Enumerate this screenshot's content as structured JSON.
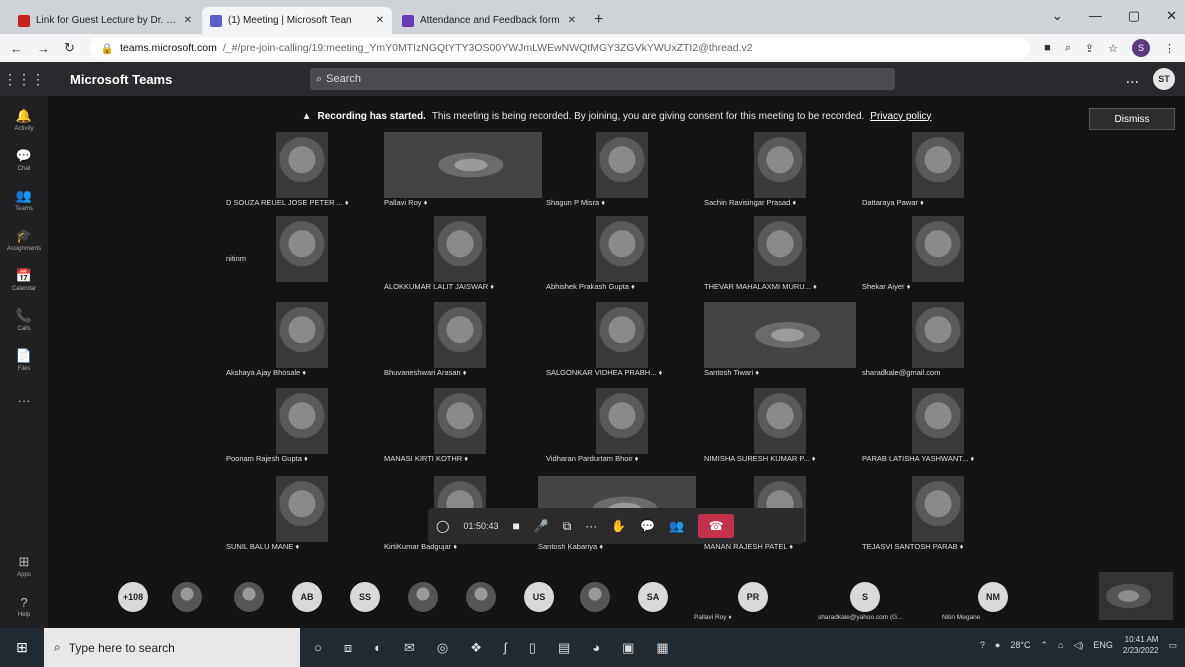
{
  "browser": {
    "tabs": [
      {
        "title": "Link for Guest Lecture by Dr. Shi",
        "favicon_color": "#c5221f",
        "active": false
      },
      {
        "title": "(1) Meeting | Microsoft Tean",
        "favicon_color": "#5b5fc7",
        "active": true
      },
      {
        "title": "Attendance and Feedback form",
        "favicon_color": "#673ab7",
        "active": false
      }
    ],
    "new_tab": "+",
    "url_host": "teams.microsoft.com",
    "url_path": "/_#/pre-join-calling/19:meeting_YmY0MTIzNGQtYTY3OS00YWJmLWEwNWQtMGY3ZGVkYWUxZTI2@thread.v2"
  },
  "teams": {
    "app_name": "Microsoft Teams",
    "search_placeholder": "Search",
    "user_initials": "ST",
    "more": "...",
    "rail": [
      {
        "icon": "🔔",
        "label": "Activity"
      },
      {
        "icon": "💬",
        "label": "Chat"
      },
      {
        "icon": "👥",
        "label": "Teams"
      },
      {
        "icon": "🎓",
        "label": "Assignments"
      },
      {
        "icon": "📅",
        "label": "Calendar"
      },
      {
        "icon": "📞",
        "label": "Calls"
      },
      {
        "icon": "📄",
        "label": "Files"
      },
      {
        "icon": "···",
        "label": ""
      }
    ],
    "rail_bottom": [
      {
        "icon": "⊞",
        "label": "Apps"
      },
      {
        "icon": "?",
        "label": "Help"
      }
    ]
  },
  "banner": {
    "title": "Recording has started.",
    "message": "This meeting is being recorded. By joining, you are giving consent for this meeting to be recorded.",
    "link": "Privacy policy",
    "dismiss": "Dismiss"
  },
  "participants": [
    {
      "name": "D SOUZA REUEL JOSE PETER ... ♦"
    },
    {
      "name": "Pallavi Roy ♦"
    },
    {
      "name": "Shagun P Misra ♦"
    },
    {
      "name": "Sachin Ravisingar Prasad ♦"
    },
    {
      "name": "Dattaraya Pawar ♦"
    },
    {
      "name": "nitinm"
    },
    {
      "name": "ALOKKUMAR LALIT JAISWAR ♦"
    },
    {
      "name": "Abhishek Prakash Gupta ♦"
    },
    {
      "name": "THEVAR MAHALAXMI MURU... ♦"
    },
    {
      "name": "Shekar Aiyer ♦"
    },
    {
      "name": "Akshaya Ajay Bhosale ♦"
    },
    {
      "name": "Bhuvaneshwari Arasan ♦"
    },
    {
      "name": "SALGONKAR VIDHEA PRABH... ♦"
    },
    {
      "name": "Santosh Tiwari ♦"
    },
    {
      "name": "sharadkale@gmail.com"
    },
    {
      "name": "Poonam Rajesh Gupta ♦"
    },
    {
      "name": "MANASI KIRTI KOTHR ♦"
    },
    {
      "name": "Vidharan Pardurtam Bhoir ♦"
    },
    {
      "name": "NIMISHA SURESH KUMAR P... ♦"
    },
    {
      "name": "PARAB LATISHA YASHWANT... ♦"
    },
    {
      "name": "SUNIL BALU MANE ♦"
    },
    {
      "name": "KirtiKumar Badgujar ♦"
    },
    {
      "name": "Santosh Kabariya ♦"
    },
    {
      "name": "MANAN RAJESH PATEL ♦"
    },
    {
      "name": "TEJASVI SANTOSH PARAB ♦"
    }
  ],
  "controls": {
    "timer": "01:50:43",
    "icons": [
      "video-camera",
      "microphone",
      "share-screen",
      "more-actions",
      "raise-hand",
      "chat",
      "people"
    ],
    "leave_icon": "hang-up"
  },
  "strip": {
    "overflow": "+108",
    "avatars": [
      "",
      "",
      "AB",
      "SS",
      "",
      "",
      "US",
      "",
      "SA",
      "PR",
      "S",
      "NM"
    ],
    "labels": [
      "Pallavi Roy ♦",
      "sharadkale@yahoo.com (G...",
      "Nitin Megane"
    ]
  },
  "taskbar": {
    "search_placeholder": "Type here to search",
    "temperature": "28°C",
    "language": "ENG",
    "time": "10:41 AM",
    "date": "2/23/2022"
  }
}
